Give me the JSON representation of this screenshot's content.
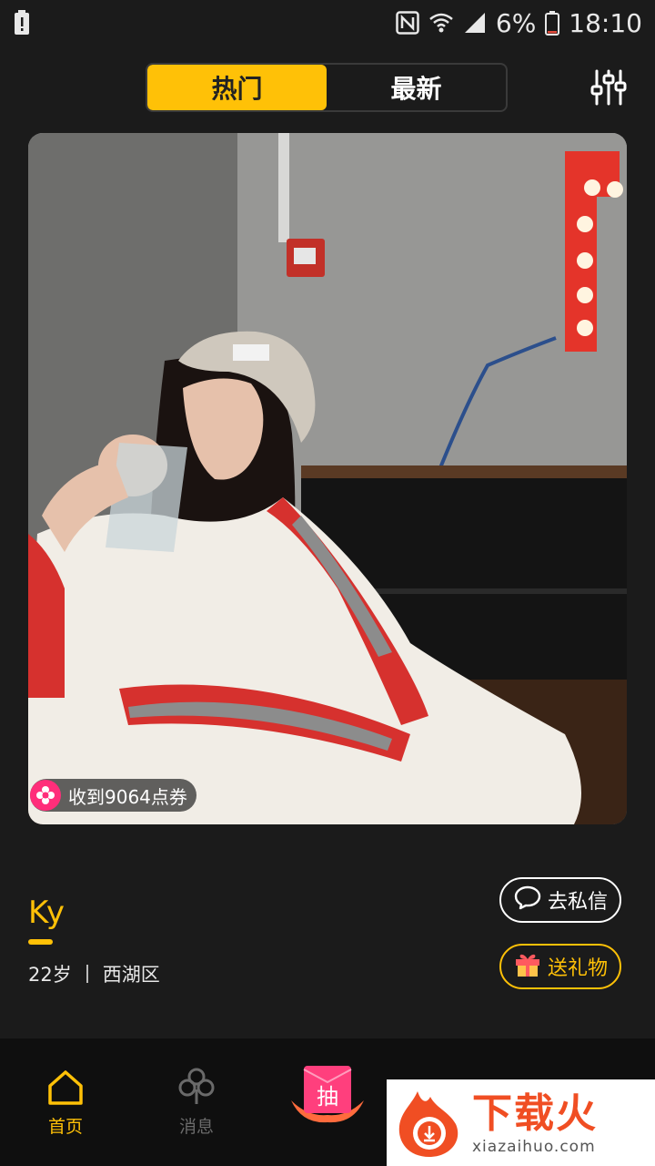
{
  "status_bar": {
    "battery_percent": "6%",
    "time": "18:10",
    "icons": [
      "battery-alert-icon",
      "nfc-icon",
      "wifi-icon",
      "signal-icon",
      "battery-icon"
    ]
  },
  "tabs": [
    {
      "label": "热门",
      "active": true
    },
    {
      "label": "最新",
      "active": false
    }
  ],
  "filter_icon": "sliders-icon",
  "card": {
    "coupon_text": "收到9064点券"
  },
  "profile": {
    "name": "Ky",
    "age": "22岁",
    "district": "西湖区"
  },
  "actions": {
    "message_label": "去私信",
    "gift_label": "送礼物"
  },
  "bottom_nav": {
    "home_label": "首页",
    "messages_label": "消息",
    "draw_label": "抽"
  },
  "watermark": {
    "cn": "下载火",
    "url": "xiazaihuo.com"
  },
  "colors": {
    "accent": "#ffc107",
    "background": "#1b1b1b",
    "coupon_pink": "#ff2e7a"
  }
}
